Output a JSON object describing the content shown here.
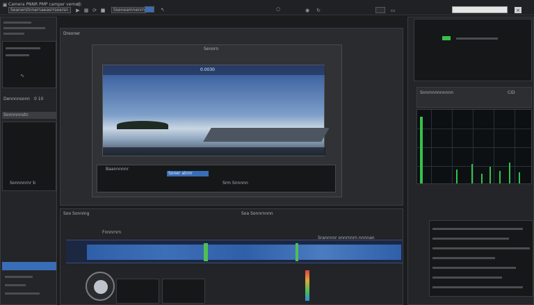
{
  "menubar": {
    "title": "Camera PNNR PMP camper verner",
    "doc_tab": "Seanerstnnernaeasrrsearsn",
    "field": "Sseneamnenrnnsrn"
  },
  "left_panel": {
    "label_a": "Dennnnsonn",
    "label_b": "Sonnnnnstn",
    "readout": "0 10",
    "list_label": "Sonnnnrnr b"
  },
  "viewer": {
    "tab_label": "Dreoner",
    "header_field": "Senorn",
    "inner_value": "0.0030",
    "bottom_left_label": "Baannnnnr",
    "bottom_tab": "Soner alnnr",
    "bottom_right_label": "Srm Snnnnn"
  },
  "timeline": {
    "tab_label": "Soo Sonning",
    "center_label": "Soa Sonnrnnnn",
    "track_label": "Fnnnrnrn",
    "overlay_text": "Srannnnr onnrnnrn nnnnan"
  },
  "right_panel": {
    "scope_title": "Snnrnnnnnnnnn",
    "scope_readout": "CID"
  },
  "colors": {
    "accent": "#3a6db8",
    "meter_green": "#35c24a",
    "waveform_blue": "#2f5fa8"
  }
}
